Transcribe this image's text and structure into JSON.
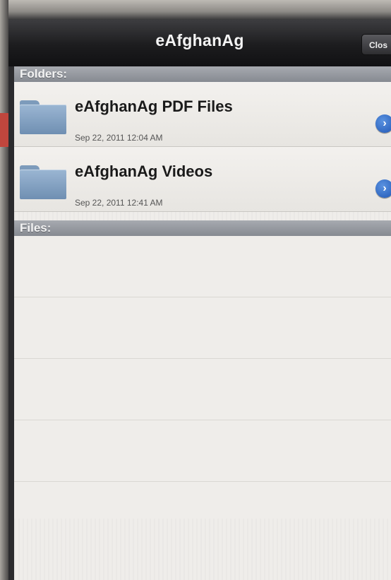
{
  "navbar": {
    "title": "eAfghanAg",
    "close_label": "Clos"
  },
  "sections": {
    "folders_label": "Folders:",
    "files_label": "Files:"
  },
  "folders": [
    {
      "name": "eAfghanAg PDF Files",
      "date": "Sep 22, 2011 12:04 AM",
      "icon": "folder-icon",
      "accessory": "disclosure-icon"
    },
    {
      "name": "eAfghanAg Videos",
      "date": "Sep 22, 2011 12:41 AM",
      "icon": "folder-icon",
      "accessory": "disclosure-icon"
    }
  ],
  "colors": {
    "navbar": "#1c1c1e",
    "section_header": "#868a91",
    "disclosure": "#2057b5",
    "folder": "#7d9bbb"
  }
}
